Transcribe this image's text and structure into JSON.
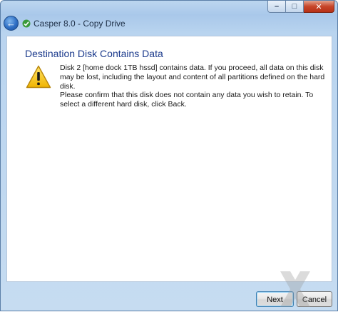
{
  "window": {
    "title": "Casper 8.0 - Copy Drive",
    "minimize_glyph": "–",
    "maximize_glyph": "□",
    "close_glyph": "✕",
    "back_glyph": "←"
  },
  "content": {
    "heading": "Destination Disk Contains Data",
    "message1": "Disk 2 [home dock 1TB hssd] contains data. If you proceed, all data on this disk may be lost, including the layout and content of all partitions defined on the hard disk.",
    "message2": "Please confirm that this disk does not contain any data you wish to retain. To select a different hard disk, click Back."
  },
  "footer": {
    "next_label": "Next",
    "cancel_label": "Cancel"
  },
  "icons": {
    "back": "back-arrow-icon",
    "app": "casper-app-icon",
    "warning": "warning-triangle-icon"
  },
  "colors": {
    "heading": "#1b3a8c",
    "close_button": "#c7452a",
    "warning_fill": "#f5c400"
  }
}
